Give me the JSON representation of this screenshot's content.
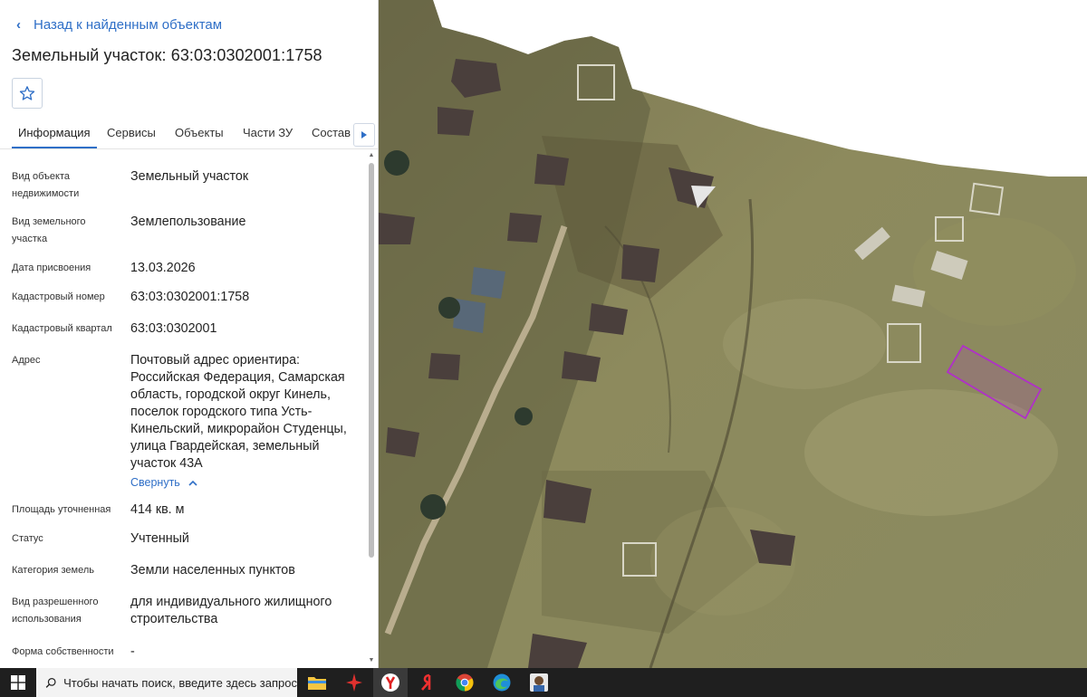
{
  "panel": {
    "back_label": "Назад к найденным объектам",
    "title": "Земельный участок: 63:03:0302001:1758",
    "tabs": [
      {
        "label": "Информация",
        "active": true
      },
      {
        "label": "Сервисы",
        "active": false
      },
      {
        "label": "Объекты",
        "active": false
      },
      {
        "label": "Части ЗУ",
        "active": false
      },
      {
        "label": "Состав",
        "active": false
      }
    ],
    "rows": [
      {
        "label": "Вид объекта недвижимости",
        "value": "Земельный участок"
      },
      {
        "label": "Вид земельного участка",
        "value": "Землепользование"
      },
      {
        "label": "Дата присвоения",
        "value": "13.03.2026"
      },
      {
        "label": "Кадастровый номер",
        "value": "63:03:0302001:1758"
      },
      {
        "label": "Кадастровый квартал",
        "value": "63:03:0302001"
      },
      {
        "label": "Адрес",
        "value": "Почтовый адрес ориентира: Российская Федерация, Самарская область, городской округ Кинель, поселок городского типа Усть-Кинельский, микрорайон Студенцы, улица Гвардейская, земельный участок 43А"
      },
      {
        "label": "Площадь уточненная",
        "value": "414 кв. м"
      },
      {
        "label": "Статус",
        "value": "Учтенный"
      },
      {
        "label": "Категория земель",
        "value": "Земли населенных пунктов"
      },
      {
        "label": "Вид разрешенного использования",
        "value": "для индивидуального жилищного строительства"
      },
      {
        "label": "Форма собственности",
        "value": "-"
      }
    ],
    "collapse_label": "Свернуть"
  },
  "taskbar": {
    "search_placeholder": "Чтобы начать поиск, введите здесь запрос",
    "apps": [
      "file-explorer",
      "app-red",
      "yandex-browser",
      "yandex",
      "chrome",
      "edge",
      "avatar-app"
    ]
  },
  "colors": {
    "accent": "#2f6fc7",
    "parcel_outline": "#b030c8",
    "taskbar": "#1f1f1f"
  }
}
